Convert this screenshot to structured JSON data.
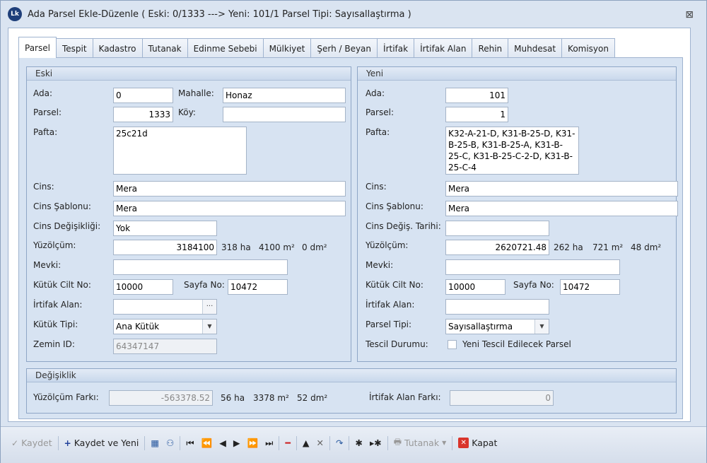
{
  "window": {
    "title": "Ada Parsel Ekle-Düzenle ( Eski: 0/1333 ---> Yeni: 101/1 Parsel Tipi: Sayısallaştırma )",
    "logo_text": "Lk"
  },
  "tabs": [
    "Parsel",
    "Tespit",
    "Kadastro",
    "Tutanak",
    "Edinme Sebebi",
    "Mülkiyet",
    "Şerh / Beyan",
    "İrtifak",
    "İrtifak Alan",
    "Rehin",
    "Muhdesat",
    "Komisyon"
  ],
  "eski": {
    "title": "Eski",
    "ada_label": "Ada:",
    "ada": "0",
    "mahalle_label": "Mahalle:",
    "mahalle": "Honaz",
    "parsel_label": "Parsel:",
    "parsel": "1333",
    "koy_label": "Köy:",
    "koy": "",
    "pafta_label": "Pafta:",
    "pafta": "25c21d",
    "cins_label": "Cins:",
    "cins": "Mera",
    "cins_sablonu_label": "Cins Şablonu:",
    "cins_sablonu": "Mera",
    "cins_degisikligi_label": "Cins Değişikliği:",
    "cins_degisikligi": "Yok",
    "yuzolcum_label": "Yüzölçüm:",
    "yuzolcum": "3184100",
    "ha": "318 ha",
    "m2": "4100 m²",
    "dm2": "0 dm²",
    "mevki_label": "Mevki:",
    "mevki": "",
    "kutuk_cilt_label": "Kütük Cilt No:",
    "kutuk_cilt": "10000",
    "sayfa_label": "Sayfa No:",
    "sayfa": "10472",
    "irtifak_alan_label": "İrtifak Alan:",
    "irtifak_alan": "",
    "irtifak_btn": "···",
    "kutuk_tipi_label": "Kütük Tipi:",
    "kutuk_tipi": "Ana Kütük",
    "zemin_id_label": "Zemin ID:",
    "zemin_id": "64347147"
  },
  "yeni": {
    "title": "Yeni",
    "ada_label": "Ada:",
    "ada": "101",
    "parsel_label": "Parsel:",
    "parsel": "1",
    "pafta_label": "Pafta:",
    "pafta": "K32-A-21-D, K31-B-25-D, K31-B-25-B, K31-B-25-A, K31-B-25-C, K31-B-25-C-2-D, K31-B-25-C-4",
    "cins_label": "Cins:",
    "cins": "Mera",
    "cins_sablonu_label": "Cins Şablonu:",
    "cins_sablonu": "Mera",
    "cins_degis_tarihi_label": "Cins Değiş. Tarihi:",
    "cins_degis_tarihi": "",
    "yuzolcum_label": "Yüzölçüm:",
    "yuzolcum": "2620721.48",
    "ha": "262 ha",
    "m2": "721 m²",
    "dm2": "48 dm²",
    "mevki_label": "Mevki:",
    "mevki": "",
    "kutuk_cilt_label": "Kütük Cilt No:",
    "kutuk_cilt": "10000",
    "sayfa_label": "Sayfa No:",
    "sayfa": "10472",
    "irtifak_alan_label": "İrtifak Alan:",
    "irtifak_alan": "",
    "parsel_tipi_label": "Parsel Tipi:",
    "parsel_tipi": "Sayısallaştırma",
    "tescil_durumu_label": "Tescil Durumu:",
    "tescil_checkbox_label": "Yeni Tescil Edilecek Parsel"
  },
  "degisiklik": {
    "title": "Değişiklik",
    "yuzolcum_farki_label": "Yüzölçüm Farkı:",
    "yuzolcum_farki": "-563378.52",
    "ha": "56 ha",
    "m2": "3378 m²",
    "dm2": "52 dm²",
    "irtifak_alan_farki_label": "İrtifak Alan Farkı:",
    "irtifak_alan_farki": "0"
  },
  "toolbar": {
    "kaydet": "Kaydet",
    "kaydet_ve_yeni": "Kaydet ve Yeni",
    "tutanak": "Tutanak",
    "kapat": "Kapat"
  },
  "colors": {
    "accent": "#1f3f7a",
    "panel": "#d7e3f2",
    "close_red": "#d9342b",
    "delete_red": "#cc2222"
  }
}
